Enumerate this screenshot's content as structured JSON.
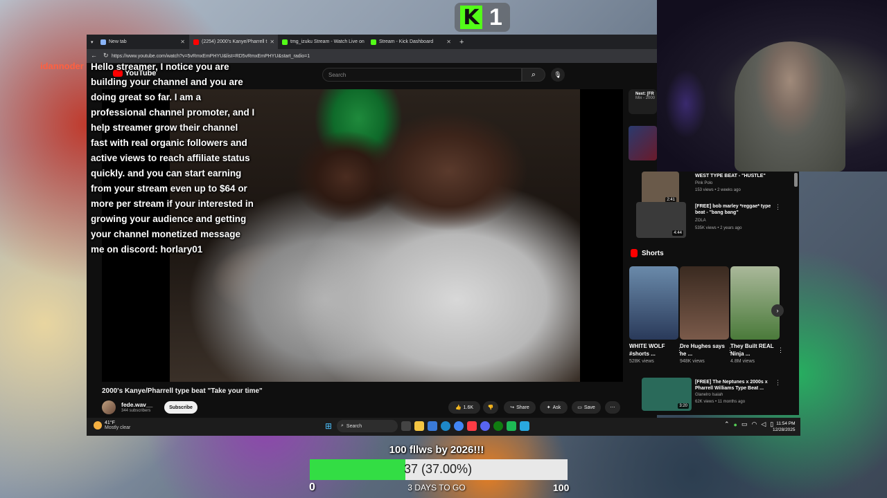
{
  "overlay": {
    "kick_count": "1",
    "username": "idannoder",
    "goal": {
      "title": "100 fllws by 2026!!!",
      "count_label": "37 (37.00%)",
      "progress_fraction": 0.37,
      "min_label": "0",
      "max_label": "100",
      "days_label": "3 DAYS TO GO",
      "fill_color": "#33dd44"
    }
  },
  "browser": {
    "tabs": [
      {
        "label": "New tab",
        "icon_color": "#8ab4f8"
      },
      {
        "label": "(2254) 2000's Kanye/Pharrell t",
        "icon_color": "#ff0000"
      },
      {
        "label": "tmg_izuku Stream - Watch Live on",
        "icon_color": "#53fc18"
      },
      {
        "label": "Stream - Kick Dashboard",
        "icon_color": "#53fc18"
      }
    ],
    "new_tab_label": "+",
    "url": "https://www.youtube.com/watch?v=5vRmxEmPHYU&list=RD5vRmxEmPHYU&start_radio=1"
  },
  "youtube": {
    "logo_text": "YouTube",
    "search_placeholder": "Search",
    "promo_message": "Hello streamer, I notice you are building your channel and you are doing great so far. I am a professional channel promoter, and I help streamer grow their channel fast with real organic followers and active views to reach affiliate status quickly. and you can start earning from your stream even up to $64 or more per stream if your interested in growing your audience and getting your channel monetized message me on discord: horlary01",
    "video_title": "2000's Kanye/Pharrell type beat \"Take your time\"",
    "channel_name": "fede.wav__",
    "subscribers": "344 subscribers",
    "subscribe_label": "Subscribe",
    "like_count": "1.6K",
    "share_label": "Share",
    "ask_label": "Ask",
    "save_label": "Save",
    "next_label": "Next: [FR",
    "next_sub": "Mix - 2000",
    "recommendations": [
      {
        "title": "WEST TYPE BEAT - \"HUSTLE\"",
        "channel": "Pink Polo",
        "meta": "153 views • 2 weeks ago",
        "duration": "2:41",
        "color": "#6a5a4a"
      },
      {
        "title": "[FREE] bob marley *reggae* type beat - \"bang bang\"",
        "channel": "ZOLA",
        "meta": "535K views • 2 years ago",
        "duration": "4:44",
        "color": "#3a3a3a"
      }
    ],
    "shorts_label": "Shorts",
    "shorts": [
      {
        "title": "WHITE WOLF #shorts ...",
        "views": "528K views",
        "color": "#4a6a8a"
      },
      {
        "title": "Dre Hughes says he ...",
        "views": "948K views",
        "color": "#5a3a2a"
      },
      {
        "title": "They Built REAL Ninja ...",
        "views": "4.8M views",
        "color": "#4a7a3a"
      }
    ],
    "last_rec": {
      "title": "[FREE] The Neptunes x 2000s x Pharrell Williams Type Beat ...",
      "channel": "Glanelro Isaiah",
      "meta": "62K views • 11 months ago",
      "duration": "3:20",
      "color": "#2a6a5a"
    }
  },
  "taskbar": {
    "temperature": "41°F",
    "weather": "Mostly clear",
    "search_label": "Search",
    "time": "11:54 PM",
    "date": "12/28/2025"
  }
}
